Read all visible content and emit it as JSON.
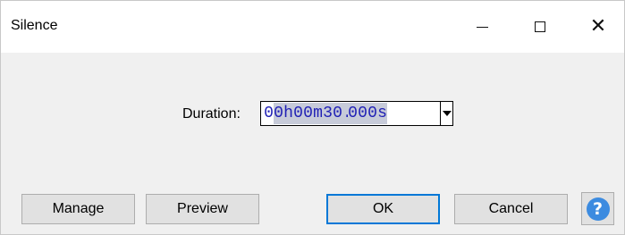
{
  "window": {
    "title": "Silence",
    "minimize_icon": "minimize-icon",
    "maximize_icon": "maximize-icon",
    "close_icon": "close-icon",
    "close_glyph": "✕"
  },
  "duration": {
    "label": "Duration:",
    "segments": [
      "0",
      "0",
      "h",
      "0",
      "0",
      "m",
      "3",
      "0",
      ".",
      "0",
      "0",
      "0",
      "s"
    ],
    "value_text": "00h00m30.000s"
  },
  "buttons": {
    "manage": "Manage",
    "preview": "Preview",
    "ok": "OK",
    "cancel": "Cancel",
    "help_glyph": "?"
  },
  "colors": {
    "accent": "#0078d7",
    "digit_text": "#1f1fb5",
    "help_icon": "#3c8be0"
  }
}
